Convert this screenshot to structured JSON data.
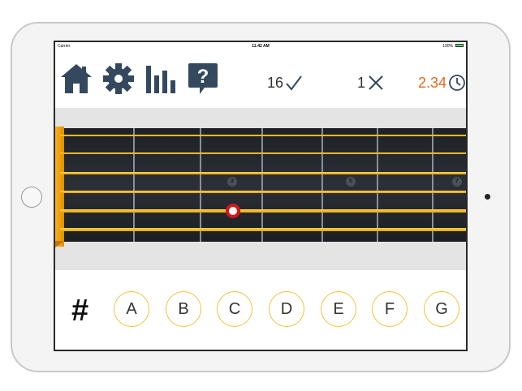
{
  "status_bar": {
    "carrier": "Carrier",
    "time": "11:42 AM",
    "battery": "100%"
  },
  "toolbar": {
    "icons": [
      "home-icon",
      "gear-icon",
      "stats-icon",
      "help-icon"
    ],
    "correct_count": "16",
    "wrong_count": "1",
    "timer_value": "2.34"
  },
  "fretboard": {
    "string_count": 6,
    "fret_markers": [
      "3",
      "5",
      "7"
    ],
    "highlighted_note": {
      "string": 5,
      "fret": 3
    }
  },
  "answer_bar": {
    "sharp_label": "#",
    "notes": [
      "A",
      "B",
      "C",
      "D",
      "E",
      "F",
      "G"
    ]
  },
  "colors": {
    "accent": "#e46a1e",
    "nut": "#f0a31c",
    "note_circle": "#f0c23c",
    "marker_red": "#d11818"
  }
}
